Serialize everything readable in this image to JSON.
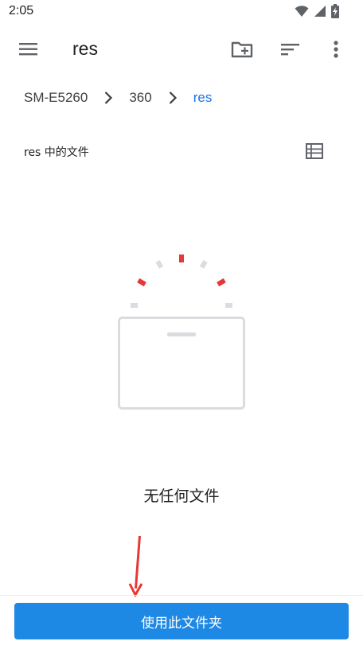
{
  "status_bar": {
    "time": "2:05",
    "icons": [
      "wifi-icon",
      "signal-icon",
      "battery-charging-icon"
    ]
  },
  "app_bar": {
    "title": "res",
    "icons": [
      "menu-icon",
      "new-folder-icon",
      "sort-icon",
      "more-vert-icon"
    ]
  },
  "breadcrumb": {
    "items": [
      "SM-E5260",
      "360",
      "res"
    ],
    "active_color": "#1a73e8"
  },
  "section": {
    "title": "res 中的文件",
    "view_icon": "list-view-icon"
  },
  "empty_state": {
    "message": "无任何文件",
    "illustration": "empty-folder-icon"
  },
  "action": {
    "use_folder_label": "使用此文件夹",
    "color": "#1e88e5"
  },
  "annotation": {
    "arrow_color": "#e53935"
  }
}
